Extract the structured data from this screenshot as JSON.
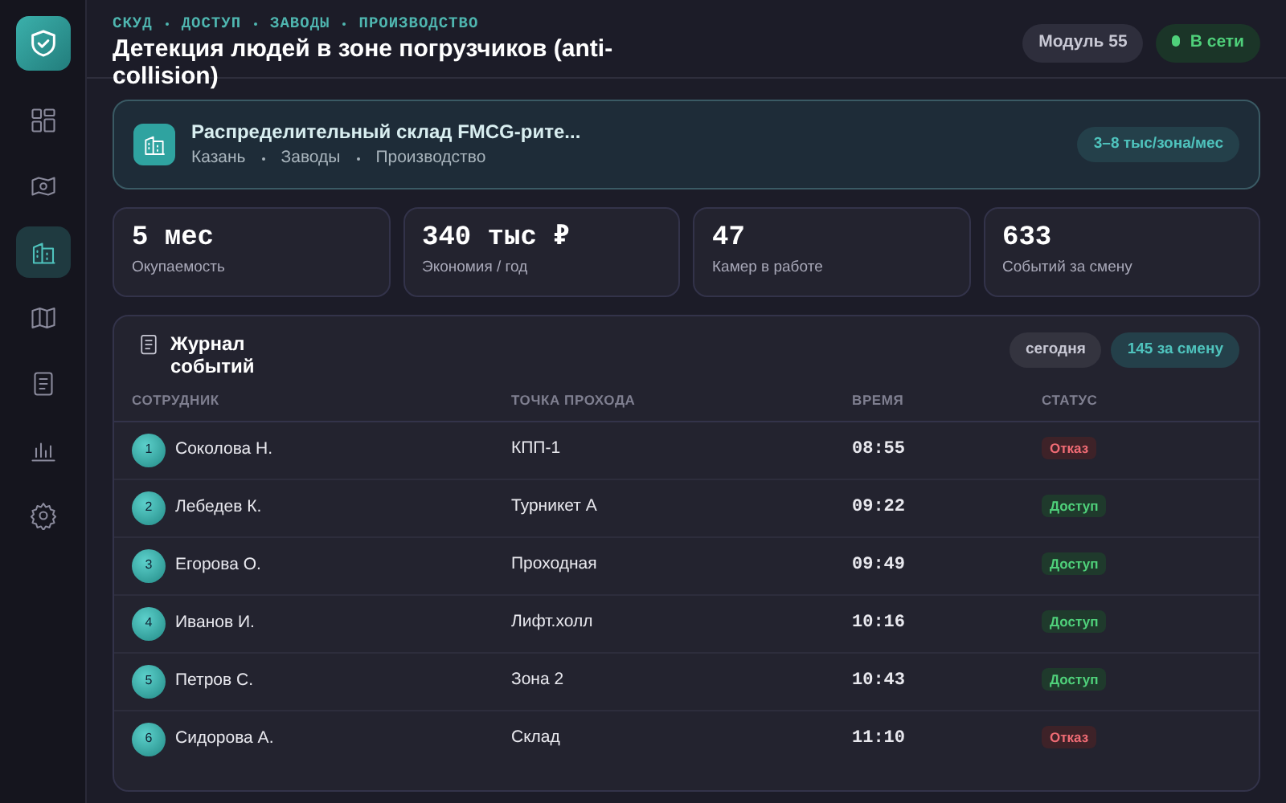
{
  "sidebar": {
    "items": [
      {
        "selected": false
      },
      {
        "selected": false
      },
      {
        "selected": true
      },
      {
        "selected": false
      },
      {
        "selected": false
      },
      {
        "selected": false
      },
      {
        "selected": false
      }
    ]
  },
  "header": {
    "breadcrumbs": [
      "СКУД",
      "ДОСТУП",
      "ЗАВОДЫ",
      "ПРОИЗВОДСТВО"
    ],
    "title": "Детекция людей в зоне погрузчиков (anti-collision)",
    "module": "Модуль 55",
    "status": {
      "label": "В сети",
      "online": true
    }
  },
  "site": {
    "name": "Распределительный склад FMCG-рите...",
    "tags": [
      "Казань",
      "Заводы",
      "Производство"
    ],
    "price": "3–8 тыс/зона/мес"
  },
  "stats": [
    {
      "value": "5 мес",
      "label": "Окупаемость"
    },
    {
      "value": "340 тыс ₽",
      "label": "Экономия / год"
    },
    {
      "value": "47",
      "label": "Камер в работе"
    },
    {
      "value": "633",
      "label": "Событий за смену"
    }
  ],
  "journal": {
    "title": "Журнал событий",
    "period": "сегодня",
    "count": "145 за смену",
    "columns": [
      "СОТРУДНИК",
      "ТОЧКА ПРОХОДА",
      "ВРЕМЯ",
      "СТАТУС"
    ],
    "rows": [
      {
        "index": "1",
        "name": "Соколова Н.",
        "point": "КПП-1",
        "time": "08:55",
        "status": "Отказ",
        "kind": "deny"
      },
      {
        "index": "2",
        "name": "Лебедев К.",
        "point": "Турникет А",
        "time": "09:22",
        "status": "Доступ",
        "kind": "allow"
      },
      {
        "index": "3",
        "name": "Егорова О.",
        "point": "Проходная",
        "time": "09:49",
        "status": "Доступ",
        "kind": "allow"
      },
      {
        "index": "4",
        "name": "Иванов И.",
        "point": "Лифт.холл",
        "time": "10:16",
        "status": "Доступ",
        "kind": "allow"
      },
      {
        "index": "5",
        "name": "Петров С.",
        "point": "Зона 2",
        "time": "10:43",
        "status": "Доступ",
        "kind": "allow"
      },
      {
        "index": "6",
        "name": "Сидорова А.",
        "point": "Склад",
        "time": "11:10",
        "status": "Отказ",
        "kind": "deny"
      }
    ]
  }
}
